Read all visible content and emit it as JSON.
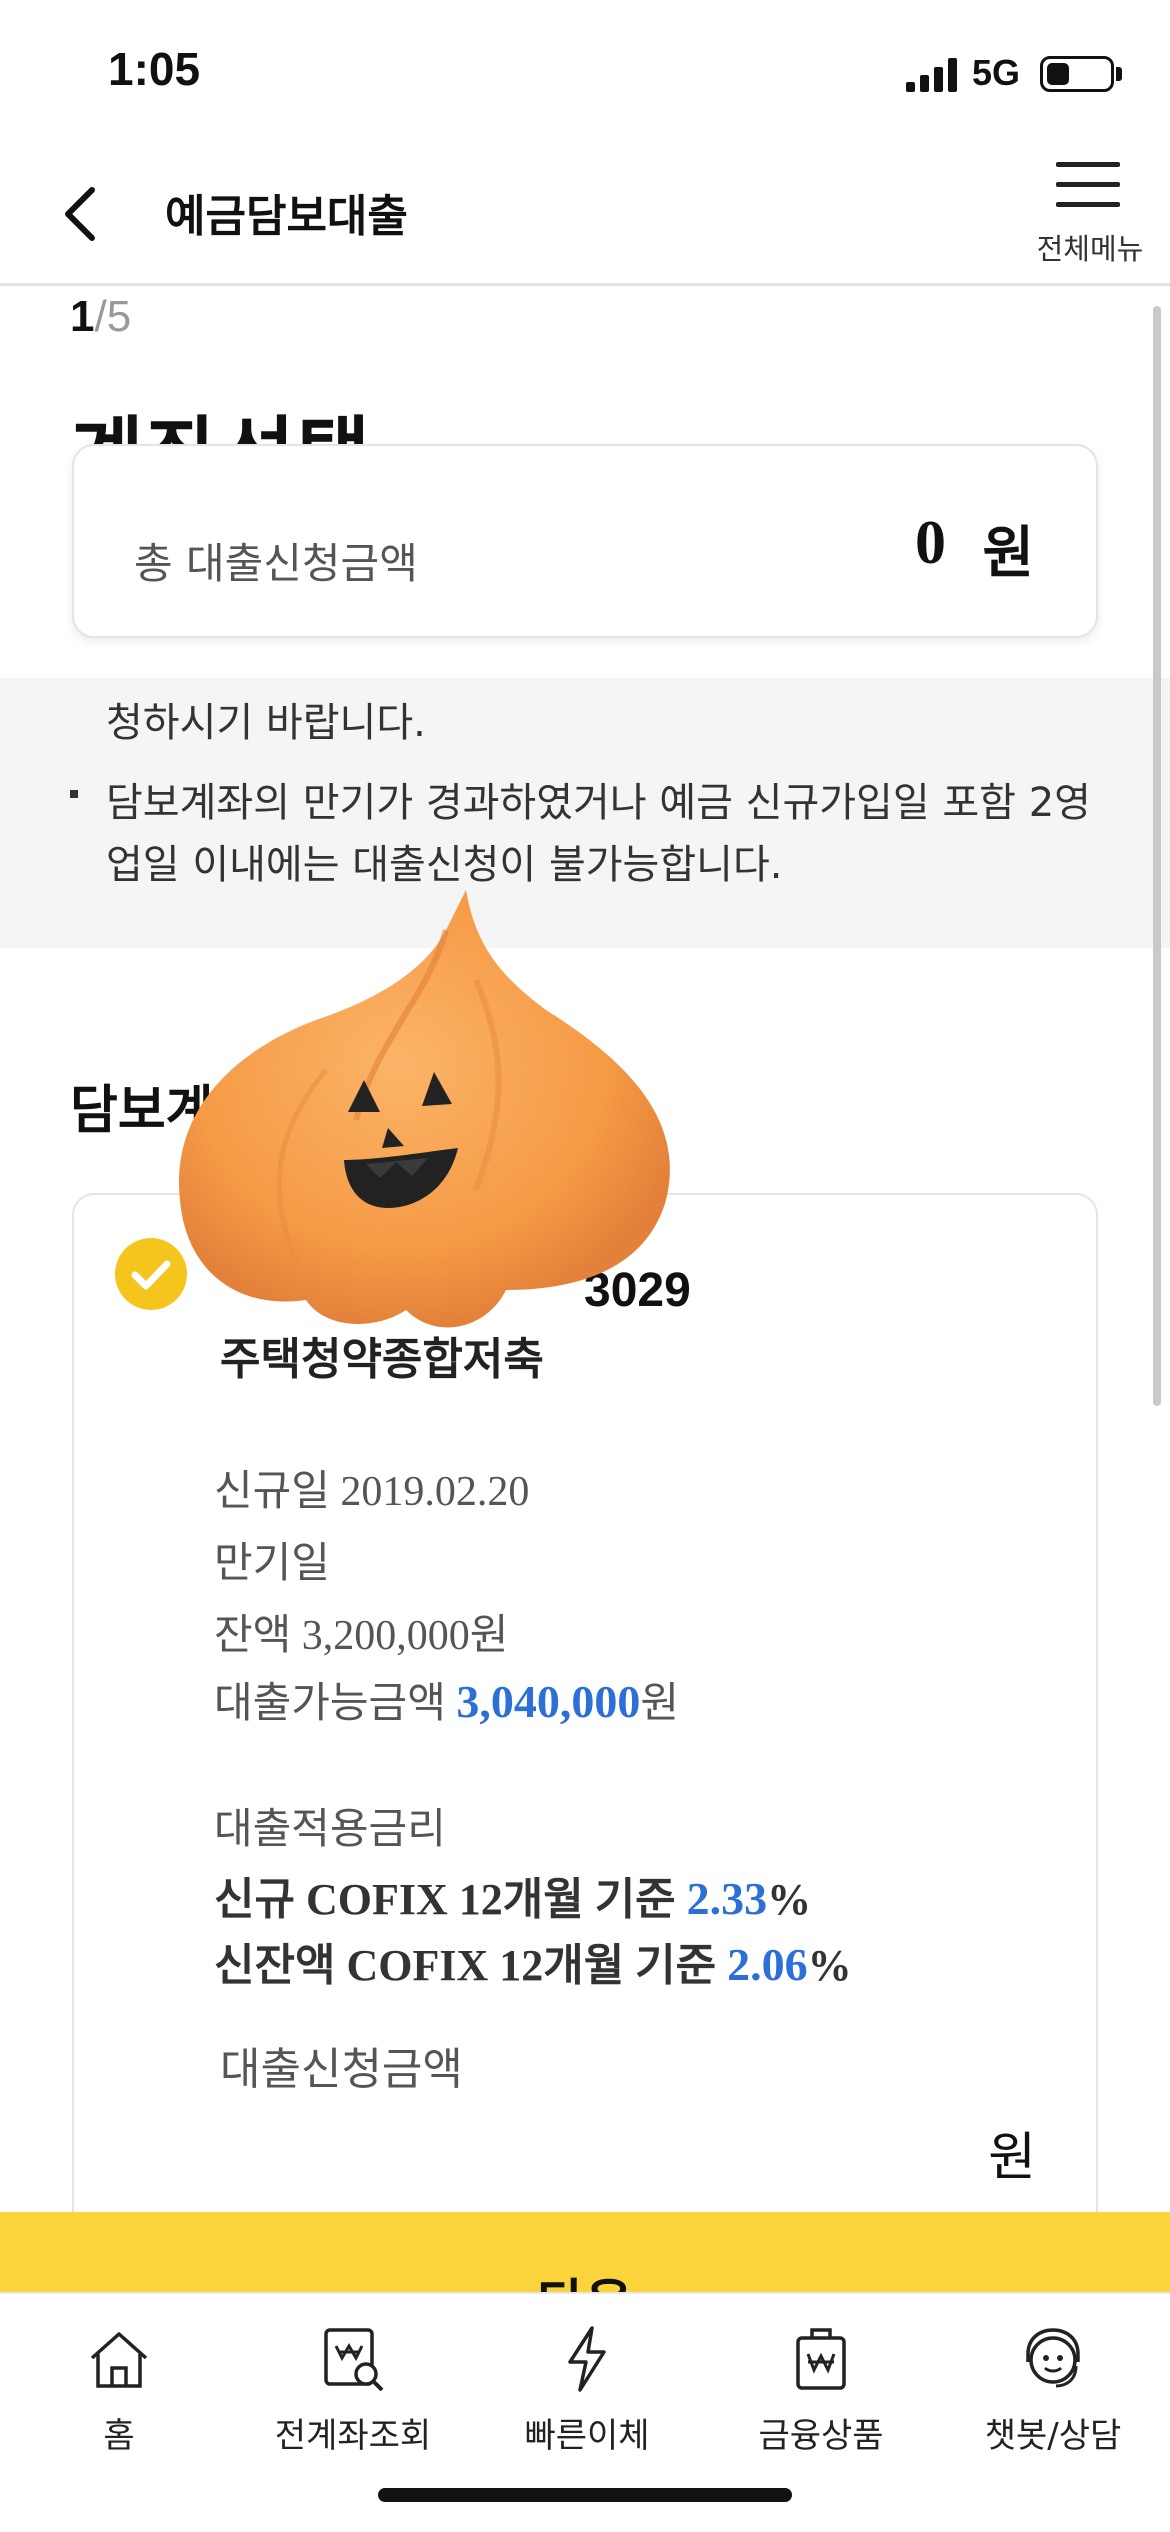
{
  "status_bar": {
    "time": "1:05",
    "network": "5G",
    "battery_level": 0.35
  },
  "header": {
    "title": "예금담보대출",
    "menu_label": "전체메뉴"
  },
  "step": {
    "current": "1",
    "total": "/5"
  },
  "page_title": "계좌선택",
  "total_card": {
    "label": "총 대출신청금액",
    "amount": "0",
    "unit": "원"
  },
  "notice": {
    "line1": "청하시기 바랍니다.",
    "line2": "담보계좌의 만기가 경과하였거나 예금 신규가입일 포함 2영업일 이내에는 대출신청이 불가능합니다."
  },
  "section_title": "담보계",
  "account": {
    "number": "3029",
    "name": "주택청약종합저축",
    "open_date_label": "신규일",
    "open_date": "2019.02.20",
    "maturity_label": "만기일",
    "balance_label": "잔액",
    "balance": "3,200,000원",
    "available_label": "대출가능금액",
    "available_amount": "3,040,000",
    "available_unit": "원",
    "rate_title": "대출적용금리",
    "rate1_label": "신규 COFIX 12개월 기준",
    "rate1_value": "2.33",
    "rate_unit": "%",
    "rate2_label": "신잔액 COFIX 12개월 기준",
    "rate2_value": "2.06",
    "apply_label": "대출신청금액",
    "apply_unit": "원"
  },
  "next_button": {
    "label": "다음"
  },
  "tabs": [
    {
      "label": "홈",
      "icon": "home-icon"
    },
    {
      "label": "전계좌조회",
      "icon": "account-search-icon"
    },
    {
      "label": "빠른이체",
      "icon": "lightning-icon"
    },
    {
      "label": "금융상품",
      "icon": "product-bag-icon"
    },
    {
      "label": "챗봇/상담",
      "icon": "chatbot-icon"
    }
  ],
  "colors": {
    "accent_yellow": "#fbd33b",
    "check_yellow": "#f5c41d",
    "highlight_blue": "#2c6fd6",
    "pumpkin_orange": "#f59a45"
  }
}
